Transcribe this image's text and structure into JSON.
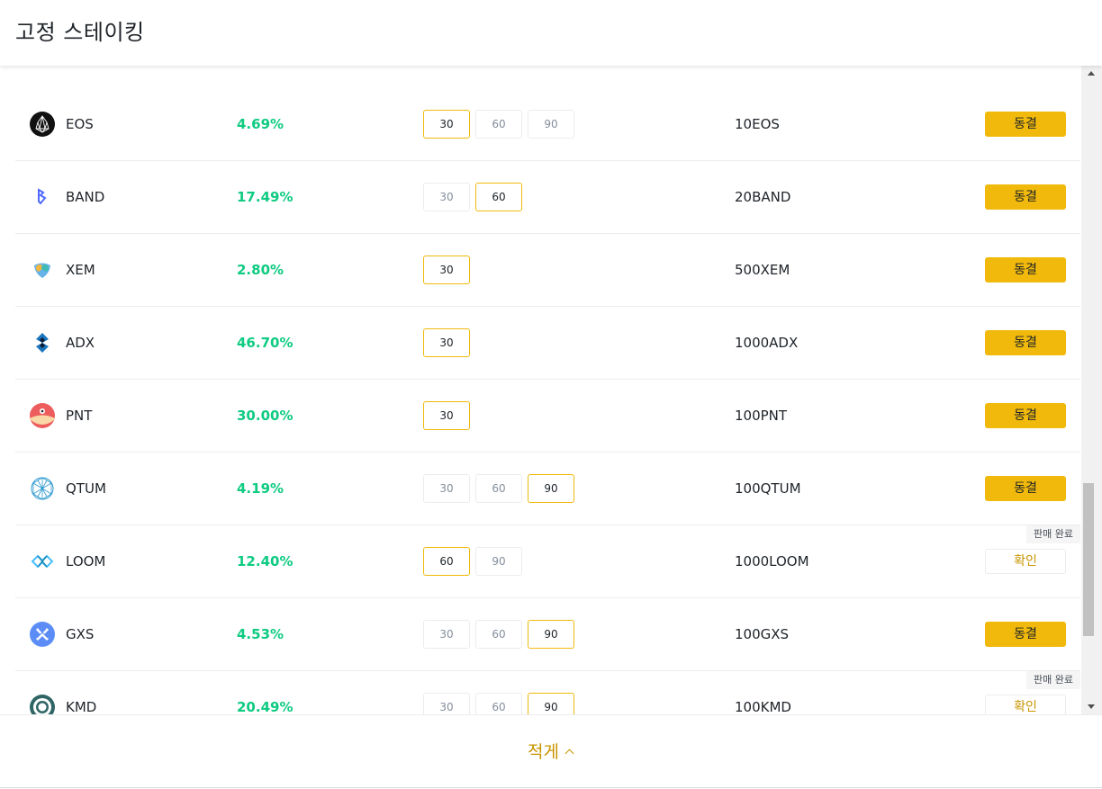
{
  "header": {
    "title": "고정 스테이킹"
  },
  "rows": [
    {
      "coin": "EOS",
      "icon": "eos-icon",
      "apy": "4.69%",
      "durations": [
        "30",
        "60",
        "90"
      ],
      "selected": "30",
      "min_amount": "10EOS",
      "action": "동결",
      "action_type": "lock",
      "sold_out": ""
    },
    {
      "coin": "BAND",
      "icon": "band-icon",
      "apy": "17.49%",
      "durations": [
        "30",
        "60"
      ],
      "selected": "60",
      "min_amount": "20BAND",
      "action": "동결",
      "action_type": "lock",
      "sold_out": ""
    },
    {
      "coin": "XEM",
      "icon": "xem-icon",
      "apy": "2.80%",
      "durations": [
        "30"
      ],
      "selected": "30",
      "min_amount": "500XEM",
      "action": "동결",
      "action_type": "lock",
      "sold_out": ""
    },
    {
      "coin": "ADX",
      "icon": "adx-icon",
      "apy": "46.70%",
      "durations": [
        "30"
      ],
      "selected": "30",
      "min_amount": "1000ADX",
      "action": "동결",
      "action_type": "lock",
      "sold_out": ""
    },
    {
      "coin": "PNT",
      "icon": "pnt-icon",
      "apy": "30.00%",
      "durations": [
        "30"
      ],
      "selected": "30",
      "min_amount": "100PNT",
      "action": "동결",
      "action_type": "lock",
      "sold_out": ""
    },
    {
      "coin": "QTUM",
      "icon": "qtum-icon",
      "apy": "4.19%",
      "durations": [
        "30",
        "60",
        "90"
      ],
      "selected": "90",
      "min_amount": "100QTUM",
      "action": "동결",
      "action_type": "lock",
      "sold_out": ""
    },
    {
      "coin": "LOOM",
      "icon": "loom-icon",
      "apy": "12.40%",
      "durations": [
        "60",
        "90"
      ],
      "selected": "60",
      "min_amount": "1000LOOM",
      "action": "확인",
      "action_type": "confirm",
      "sold_out": "판매 완료"
    },
    {
      "coin": "GXS",
      "icon": "gxs-icon",
      "apy": "4.53%",
      "durations": [
        "30",
        "60",
        "90"
      ],
      "selected": "90",
      "min_amount": "100GXS",
      "action": "동결",
      "action_type": "lock",
      "sold_out": ""
    },
    {
      "coin": "KMD",
      "icon": "kmd-icon",
      "apy": "20.49%",
      "durations": [
        "30",
        "60",
        "90"
      ],
      "selected": "90",
      "min_amount": "100KMD",
      "action": "확인",
      "action_type": "confirm",
      "sold_out": "판매 완료"
    }
  ],
  "footer": {
    "collapse_label": "적게"
  },
  "colors": {
    "accent": "#f0b90b",
    "positive": "#0ecb81",
    "link": "#c99400"
  }
}
